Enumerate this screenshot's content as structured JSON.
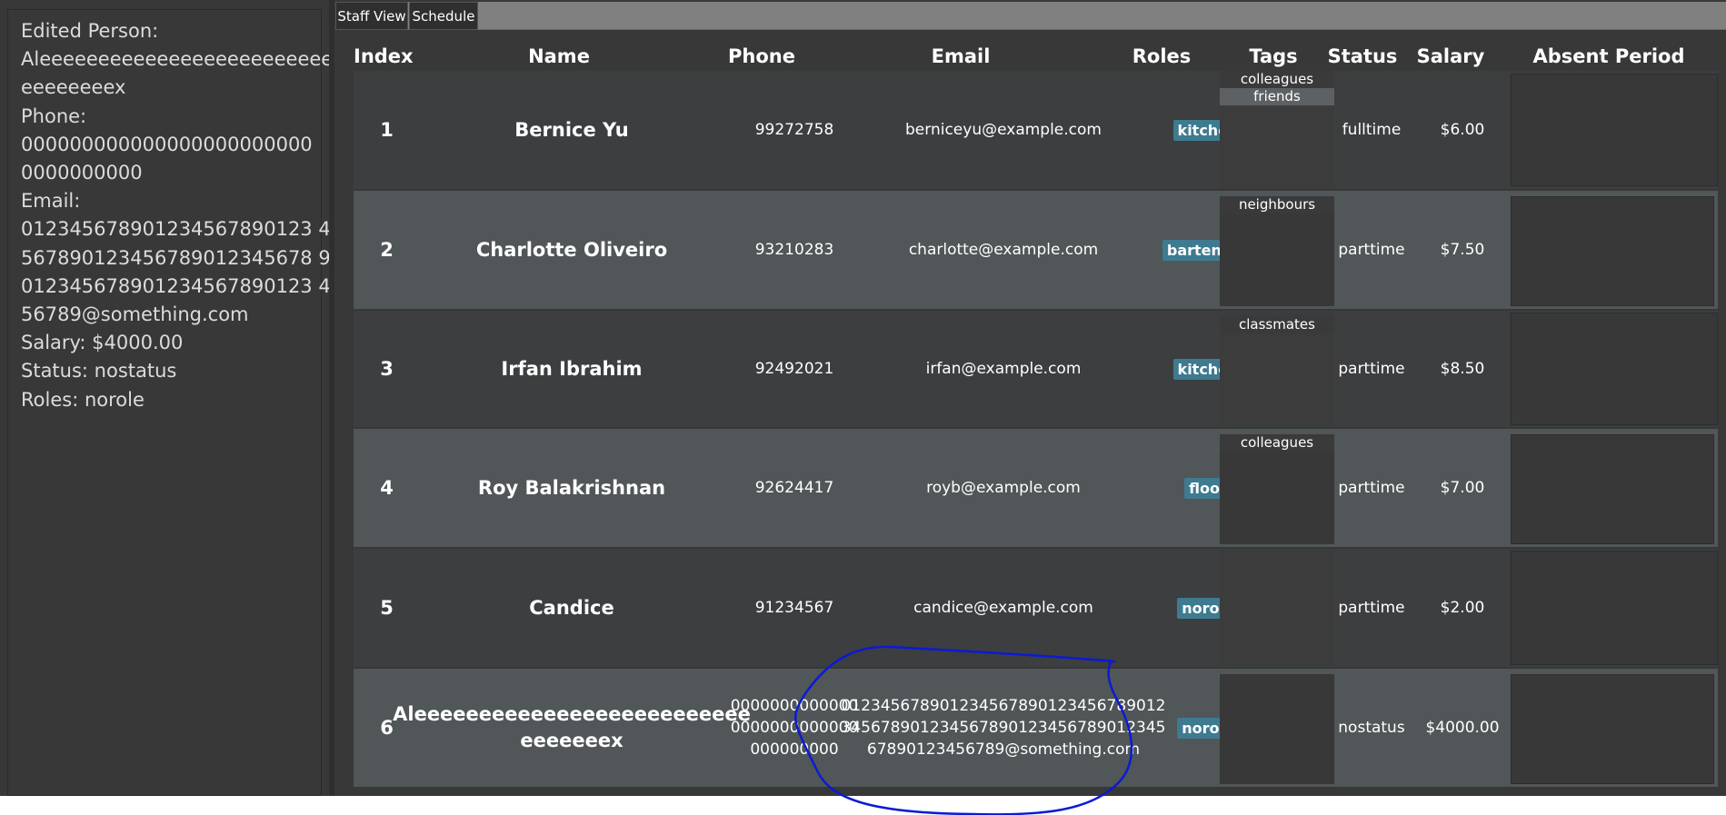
{
  "tabs": [
    "Staff View",
    "Schedule"
  ],
  "left_panel": {
    "lines": [
      "Edited Person:",
      "Aleeeeeeeeeeeeeeeeeeeeeeeee",
      "eeeeeeeex",
      "Phone:",
      "000000000000000000000000",
      "0000000000",
      "Email:",
      "012345678901234567890123 4",
      "567890123456789012345678 9",
      "012345678901234567890123 4",
      "56789@something.com",
      "Salary: $4000.00",
      "Status: nostatus",
      "Roles: norole"
    ]
  },
  "table": {
    "headers": [
      "Index",
      "Name",
      "Phone",
      "Email",
      "Roles",
      "Tags",
      "Status",
      "Salary",
      "Absent Period"
    ],
    "rows": [
      {
        "index": "1",
        "name_lines": [
          "Bernice Yu"
        ],
        "phone_lines": [
          "99272758"
        ],
        "email_lines": [
          "berniceyu@example.com"
        ],
        "role": "kitchen",
        "tags": [
          "colleagues",
          "friends"
        ],
        "status": "fulltime",
        "salary": "$6.00"
      },
      {
        "index": "2",
        "name_lines": [
          "Charlotte Oliveiro"
        ],
        "phone_lines": [
          "93210283"
        ],
        "email_lines": [
          "charlotte@example.com"
        ],
        "role": "bartender",
        "tags": [
          "neighbours"
        ],
        "status": "parttime",
        "salary": "$7.50"
      },
      {
        "index": "3",
        "name_lines": [
          "Irfan Ibrahim"
        ],
        "phone_lines": [
          "92492021"
        ],
        "email_lines": [
          "irfan@example.com"
        ],
        "role": "kitchen",
        "tags": [
          "classmates"
        ],
        "status": "parttime",
        "salary": "$8.50"
      },
      {
        "index": "4",
        "name_lines": [
          "Roy Balakrishnan"
        ],
        "phone_lines": [
          "92624417"
        ],
        "email_lines": [
          "royb@example.com"
        ],
        "role": "floor",
        "tags": [
          "colleagues"
        ],
        "status": "parttime",
        "salary": "$7.00"
      },
      {
        "index": "5",
        "name_lines": [
          "Candice"
        ],
        "phone_lines": [
          "91234567"
        ],
        "email_lines": [
          "candice@example.com"
        ],
        "role": "norole",
        "tags": [],
        "status": "parttime",
        "salary": "$2.00"
      },
      {
        "index": "6",
        "name_lines": [
          "Aleeeeeeeeeeeeeeeeeeeeeeeeee",
          "eeeeeeex"
        ],
        "phone_lines": [
          "0000000000000",
          "0000000000000",
          "000000000"
        ],
        "email_lines": [
          "012345678901234567890123456789012",
          "345678901234567890123456789012345",
          "67890123456789@something.com"
        ],
        "role": "norole",
        "tags": [],
        "status": "nostatus",
        "salary": "$4000.00"
      }
    ]
  },
  "colors": {
    "background": "#383838",
    "row_odd": "#3c3e3f",
    "row_even": "#515658",
    "role_badge": "#3e7b91",
    "annotation_stroke": "#0a1ad6"
  }
}
